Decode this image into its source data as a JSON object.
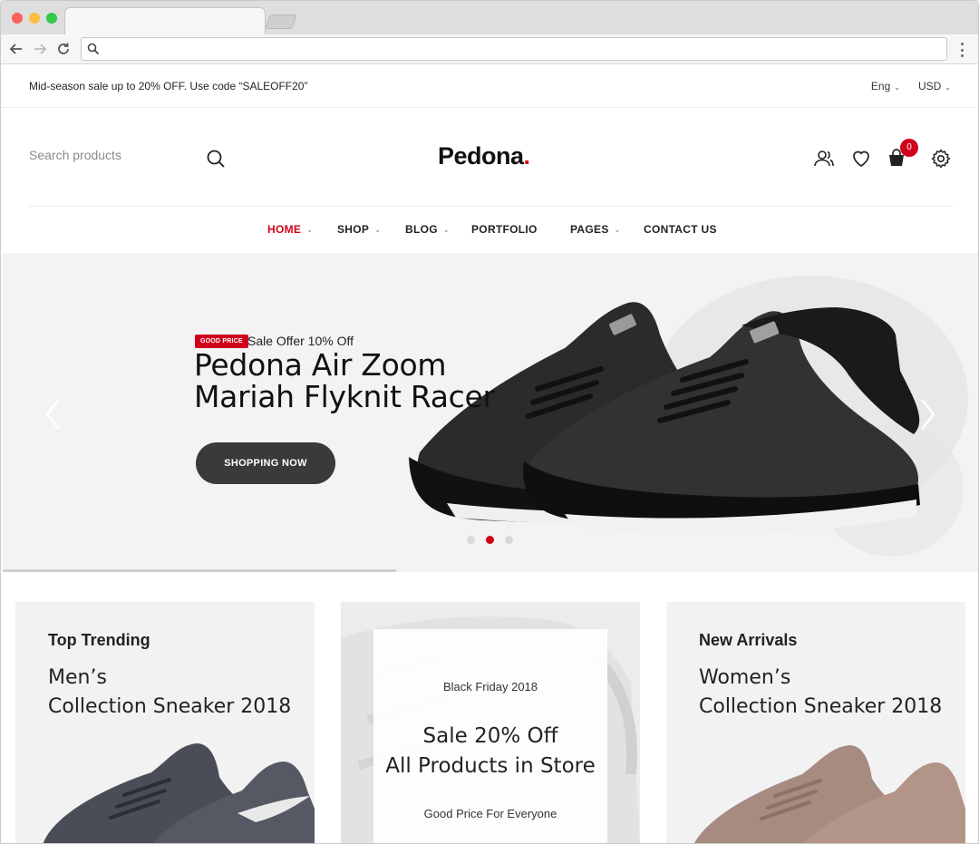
{
  "promo": {
    "text": "Mid-season sale up to 20% OFF. Use code “SALEOFF20”",
    "language": "Eng",
    "currency": "USD"
  },
  "header": {
    "search_placeholder": "Search products",
    "logo_text": "Pedona",
    "logo_dot": ".",
    "cart_count": "0"
  },
  "nav": {
    "items": [
      {
        "label": "HOME",
        "active": true,
        "has_dropdown": true
      },
      {
        "label": "SHOP",
        "has_dropdown": true
      },
      {
        "label": "BLOG",
        "has_dropdown": true
      },
      {
        "label": "PORTFOLIO",
        "has_dropdown": false
      },
      {
        "label": "PAGES",
        "has_dropdown": true
      },
      {
        "label": "CONTACT US",
        "has_dropdown": false
      }
    ]
  },
  "hero": {
    "badge": "GOOD PRICE",
    "offer": "Sale Offer 10% Off",
    "title_line1": "Pedona Air Zoom",
    "title_line2": "Mariah Flyknit Racer",
    "cta": "SHOPPING NOW",
    "active_slide": 2,
    "slide_count": 3
  },
  "banners": [
    {
      "kicker": "Top Trending",
      "title_line1": "Men’s",
      "title_line2": "Collection Sneaker 2018"
    },
    {
      "kicker": "Black Friday 2018",
      "title_line1": "Sale 20% Off",
      "title_line2": "All Products in Store",
      "sub": "Good Price For Everyone"
    },
    {
      "kicker": "New Arrivals",
      "title_line1": "Women’s",
      "title_line2": "Collection Sneaker 2018"
    }
  ],
  "colors": {
    "accent": "#d0021b",
    "button_dark": "#3a3a3a",
    "hero_bg": "#f3f3f3"
  }
}
